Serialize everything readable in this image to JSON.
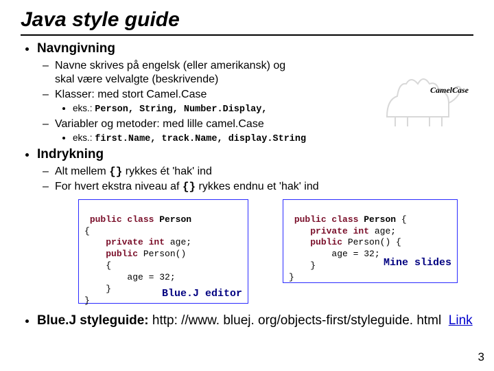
{
  "title": "Java style guide",
  "sections": {
    "navngivning": {
      "heading": "Navngivning",
      "sub": {
        "navne": "Navne skrives på engelsk (eller amerikansk) og\nskal være velvalgte (beskrivende)",
        "klasser": "Klasser: med stort Camel.Case",
        "klasser_eks_prefix": "eks.: ",
        "klasser_eks": "Person, String, Number.Display,",
        "varmet": "Variabler og metoder: med lille camel.Case",
        "varmet_eks_prefix": "eks.: ",
        "varmet_eks": "first.Name, track.Name, display.String"
      }
    },
    "indrykning": {
      "heading": "Indrykning",
      "sub": {
        "alt_pre": "Alt mellem ",
        "alt_mid": "{}",
        "alt_post": " rykkes ét 'hak' ind",
        "for_pre": "For hvert ekstra niveau af ",
        "for_mid": "{}",
        "for_post": " rykkes endnu et 'hak' ind"
      }
    }
  },
  "code": {
    "left": {
      "lines": [
        {
          "k": "public class",
          "t": " ",
          "b": "Person"
        },
        {
          "t": "{"
        },
        {
          "t": "    ",
          "k": "private int",
          "t2": " age;"
        },
        {
          "t": "    ",
          "k": "public",
          "t2": " Person()"
        },
        {
          "t": "    {"
        },
        {
          "t": "        age = 32;"
        },
        {
          "t": "    }"
        },
        {
          "t": "}"
        }
      ],
      "caption": "Blue.J editor"
    },
    "right": {
      "lines": [
        {
          "k": "public class",
          "t": " ",
          "b": "Person",
          "t2": " {"
        },
        {
          "t": "    ",
          "k": "private int",
          "t2": " age;"
        },
        {
          "t": "    ",
          "k": "public",
          "t2": " Person() {"
        },
        {
          "t": "        age = 32;"
        },
        {
          "t": "    }"
        },
        {
          "t": "}"
        }
      ],
      "caption": "Mine slides"
    }
  },
  "footer": {
    "lead": "Blue.J styleguide: ",
    "url": "http: //www. bluej. org/objects-first/styleguide. html",
    "link": "Link"
  },
  "camel_label": "CamelCase",
  "page_number": "3"
}
